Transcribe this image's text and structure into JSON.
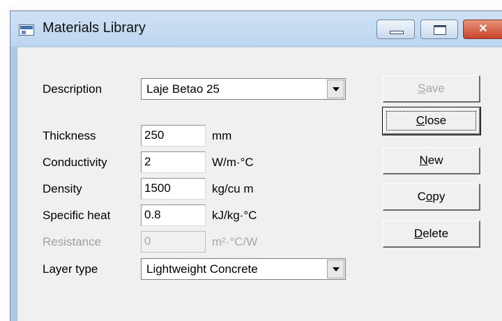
{
  "window": {
    "title": "Materials Library"
  },
  "titlebar_buttons": {
    "minimize_icon": "minimize-icon",
    "maximize_icon": "maximize-icon",
    "close_icon": "close-icon",
    "close_glyph": "✕"
  },
  "form": {
    "description": {
      "label": "Description",
      "value": "Laje Betao 25"
    },
    "thickness": {
      "label": "Thickness",
      "value": "250",
      "unit": "mm"
    },
    "conductivity": {
      "label": "Conductivity",
      "value": "2",
      "unit": "W/m·°C"
    },
    "density": {
      "label": "Density",
      "value": "1500",
      "unit": "kg/cu m"
    },
    "specific_heat": {
      "label": "Specific heat",
      "value": "0.8",
      "unit": "kJ/kg·°C"
    },
    "resistance": {
      "label": "Resistance",
      "value": "0",
      "unit": "m²·°C/W",
      "enabled": false
    },
    "layer_type": {
      "label": "Layer type",
      "value": "Lightweight Concrete"
    }
  },
  "buttons": {
    "save": {
      "mnemonic": "S",
      "rest": "ave",
      "enabled": false
    },
    "close": {
      "mnemonic": "C",
      "rest": "lose",
      "focused": true
    },
    "new": {
      "mnemonic": "N",
      "rest": "ew"
    },
    "copy": {
      "pre": "C",
      "mnemonic": "o",
      "rest": "py"
    },
    "delete": {
      "mnemonic": "D",
      "rest": "elete"
    }
  }
}
